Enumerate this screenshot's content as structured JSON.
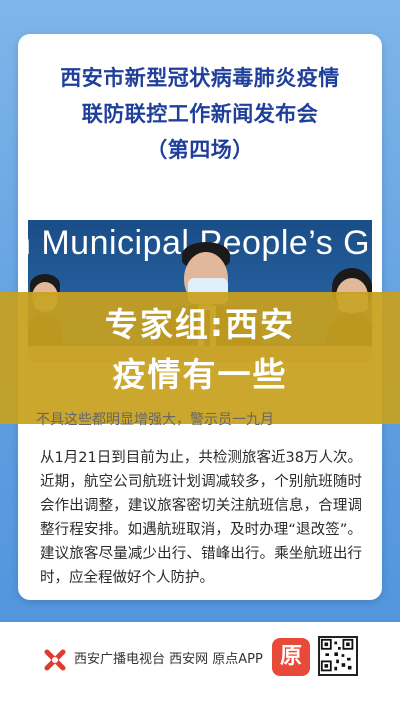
{
  "title": {
    "line1": "西安市新型冠状病毒肺炎疫情",
    "line2": "联防联控工作新闻发布会",
    "line3": "（第四场）"
  },
  "photo": {
    "backdrop_text": "n Municipal People’s G"
  },
  "headline": {
    "line1": "专家组:西安",
    "line2": "疫情有一些"
  },
  "article": {
    "faded_line": "不具这些都明显增强大，警示员一九月",
    "body": "从1月21日到目前为止，共检测旅客近38万人次。近期，航空公司航班计划调减较多，个别航班随时会作出调整，建议旅客密切关注航班信息，合理调整行程安排。如遇航班取消，及时办理“退改签”。建议旅客尽量减少出行、错峰出行。乘坐航班出行时，应全程做好个人防护。"
  },
  "footer": {
    "org_text": "西安广播电视台 西安网 原点APP",
    "app_icon_glyph": "原",
    "qr_label": "qr-code"
  },
  "colors": {
    "background": "#5e9ee0",
    "title": "#1f3f9a",
    "overlay": "#c8a01e",
    "logo_red": "#e03a2f"
  }
}
